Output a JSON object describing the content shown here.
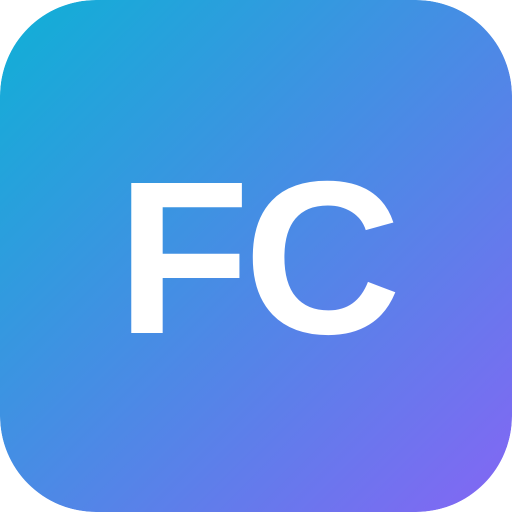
{
  "icon": {
    "monogram": "FC",
    "gradient_start": "#0FB0D6",
    "gradient_end": "#8466F4",
    "text_color": "#FFFFFF"
  }
}
